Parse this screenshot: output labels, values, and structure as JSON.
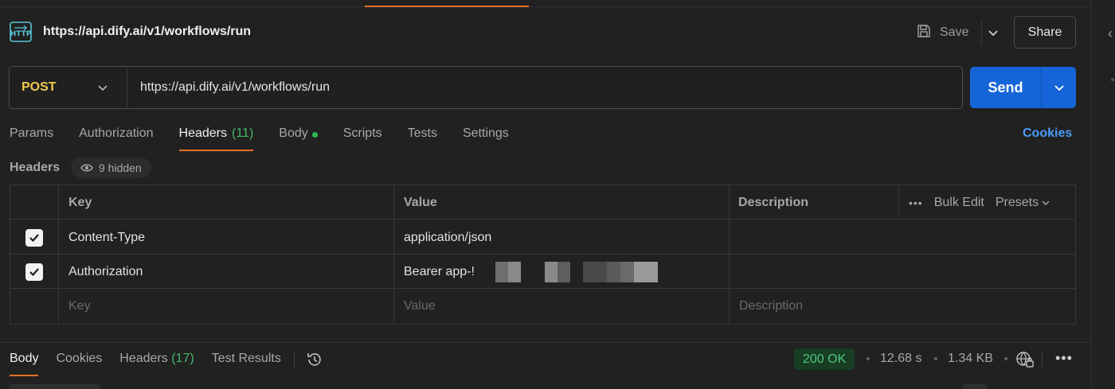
{
  "request": {
    "title": "https://api.dify.ai/v1/workflows/run",
    "method": "POST",
    "url": "https://api.dify.ai/v1/workflows/run"
  },
  "toolbar": {
    "save_label": "Save",
    "share_label": "Share",
    "send_label": "Send"
  },
  "tabs": [
    {
      "label": "Params"
    },
    {
      "label": "Authorization"
    },
    {
      "label": "Headers",
      "count": "(11)",
      "active": true
    },
    {
      "label": "Body",
      "indicator": true
    },
    {
      "label": "Scripts"
    },
    {
      "label": "Tests"
    },
    {
      "label": "Settings"
    }
  ],
  "cookies_label": "Cookies",
  "headers_section": {
    "label": "Headers",
    "hidden_label": "9 hidden"
  },
  "table": {
    "columns": {
      "key": "Key",
      "value": "Value",
      "description": "Description"
    },
    "bulk_edit": "Bulk Edit",
    "presets": "Presets",
    "rows": [
      {
        "checked": true,
        "key": "Content-Type",
        "value": "application/json",
        "description": ""
      },
      {
        "checked": true,
        "key": "Authorization",
        "value": "Bearer app-!",
        "description": ""
      }
    ],
    "placeholders": {
      "key": "Key",
      "value": "Value",
      "description": "Description"
    }
  },
  "response": {
    "tabs": [
      {
        "label": "Body",
        "active": true
      },
      {
        "label": "Cookies"
      },
      {
        "label": "Headers",
        "count": "(17)"
      },
      {
        "label": "Test Results"
      }
    ],
    "status": "200 OK",
    "time": "12.68 s",
    "size": "1.34 KB"
  },
  "colors": {
    "accent": "#e8702a",
    "send": "#1565d8",
    "method": "#f2c94c",
    "success": "#4cc77a",
    "link": "#4b9cf5"
  },
  "icons": [
    "http-icon",
    "save-icon",
    "chevron-down-icon",
    "eye-icon",
    "checkbox-icon",
    "more-icon",
    "history-icon",
    "globe-lock-icon",
    "chevron-left-icon"
  ]
}
